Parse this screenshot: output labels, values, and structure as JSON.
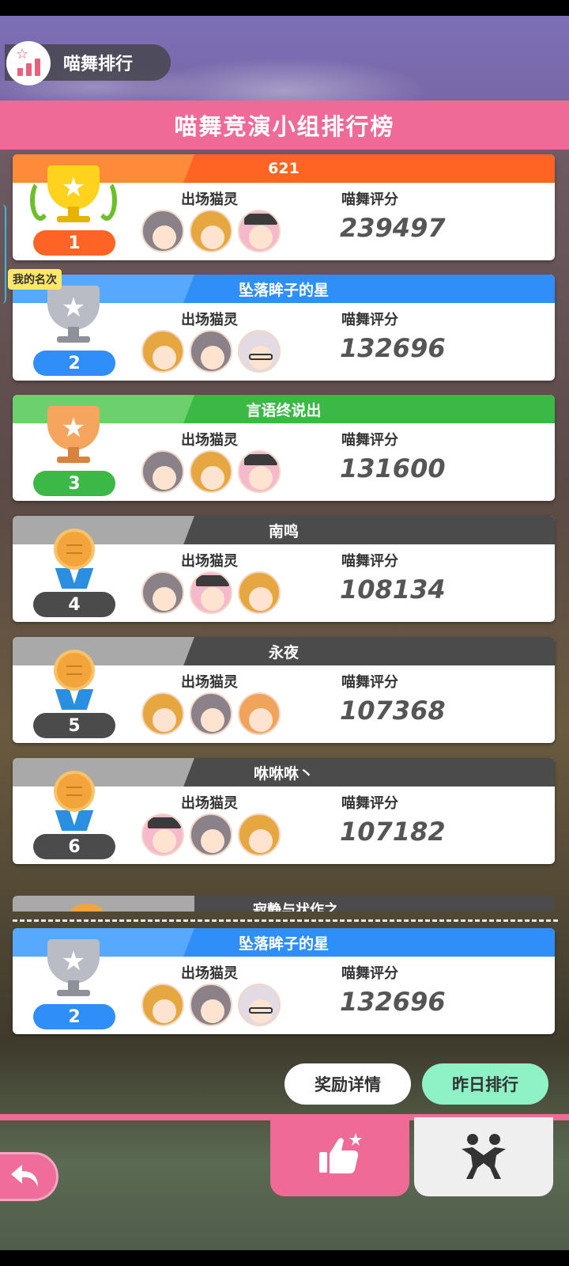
{
  "header": {
    "title_pill": "喵舞排行",
    "banner": "喵舞竞演小组排行榜",
    "my_rank_tag": "我的名次"
  },
  "labels": {
    "cats": "出场猫灵",
    "score": "喵舞评分"
  },
  "rankings": [
    {
      "rank": "1",
      "name": "621",
      "score": "239497",
      "color": "#ff6424",
      "badge": "gold-trophy",
      "avatars": [
        "gray-hair-cat",
        "gold-hair-cat",
        "pink-cap-cat"
      ]
    },
    {
      "rank": "2",
      "name": "坠落眸子的星",
      "score": "132696",
      "color": "#2f8ef7",
      "badge": "silver-trophy",
      "avatars": [
        "gold-hair-cat",
        "gray-hair-cat",
        "white-glasses-cat"
      ]
    },
    {
      "rank": "3",
      "name": "言语终说出",
      "score": "131600",
      "color": "#3bb845",
      "badge": "bronze-trophy",
      "avatars": [
        "gray-hair-cat",
        "gold-hair-cat",
        "pink-cap-cat"
      ]
    },
    {
      "rank": "4",
      "name": "南鸣",
      "score": "108134",
      "color": "#4b4b4b",
      "badge": "medal",
      "avatars": [
        "gray-hair-cat",
        "pink-cap-cat",
        "gold-hair-cat"
      ]
    },
    {
      "rank": "5",
      "name": "永夜",
      "score": "107368",
      "color": "#4b4b4b",
      "badge": "medal",
      "avatars": [
        "gold-hair-cat",
        "gray-hair-cat",
        "orange-hair-cat"
      ]
    },
    {
      "rank": "6",
      "name": "咻咻咻丶",
      "score": "107182",
      "color": "#4b4b4b",
      "badge": "medal",
      "avatars": [
        "pink-cap-cat",
        "gray-hair-cat",
        "gold-hair-cat"
      ]
    }
  ],
  "peek_name": "寂静与状作之",
  "my_entry": {
    "rank": "2",
    "name": "坠落眸子的星",
    "score": "132696",
    "color": "#2f8ef7",
    "badge": "silver-trophy",
    "avatars": [
      "gold-hair-cat",
      "gray-hair-cat",
      "white-glasses-cat"
    ]
  },
  "buttons": {
    "reward_details": "奖励详情",
    "yesterday_ranking": "昨日排行"
  },
  "icons": {
    "back": "back-arrow-icon",
    "like": "thumbs-up-star-icon",
    "dance": "dancing-people-icon"
  }
}
